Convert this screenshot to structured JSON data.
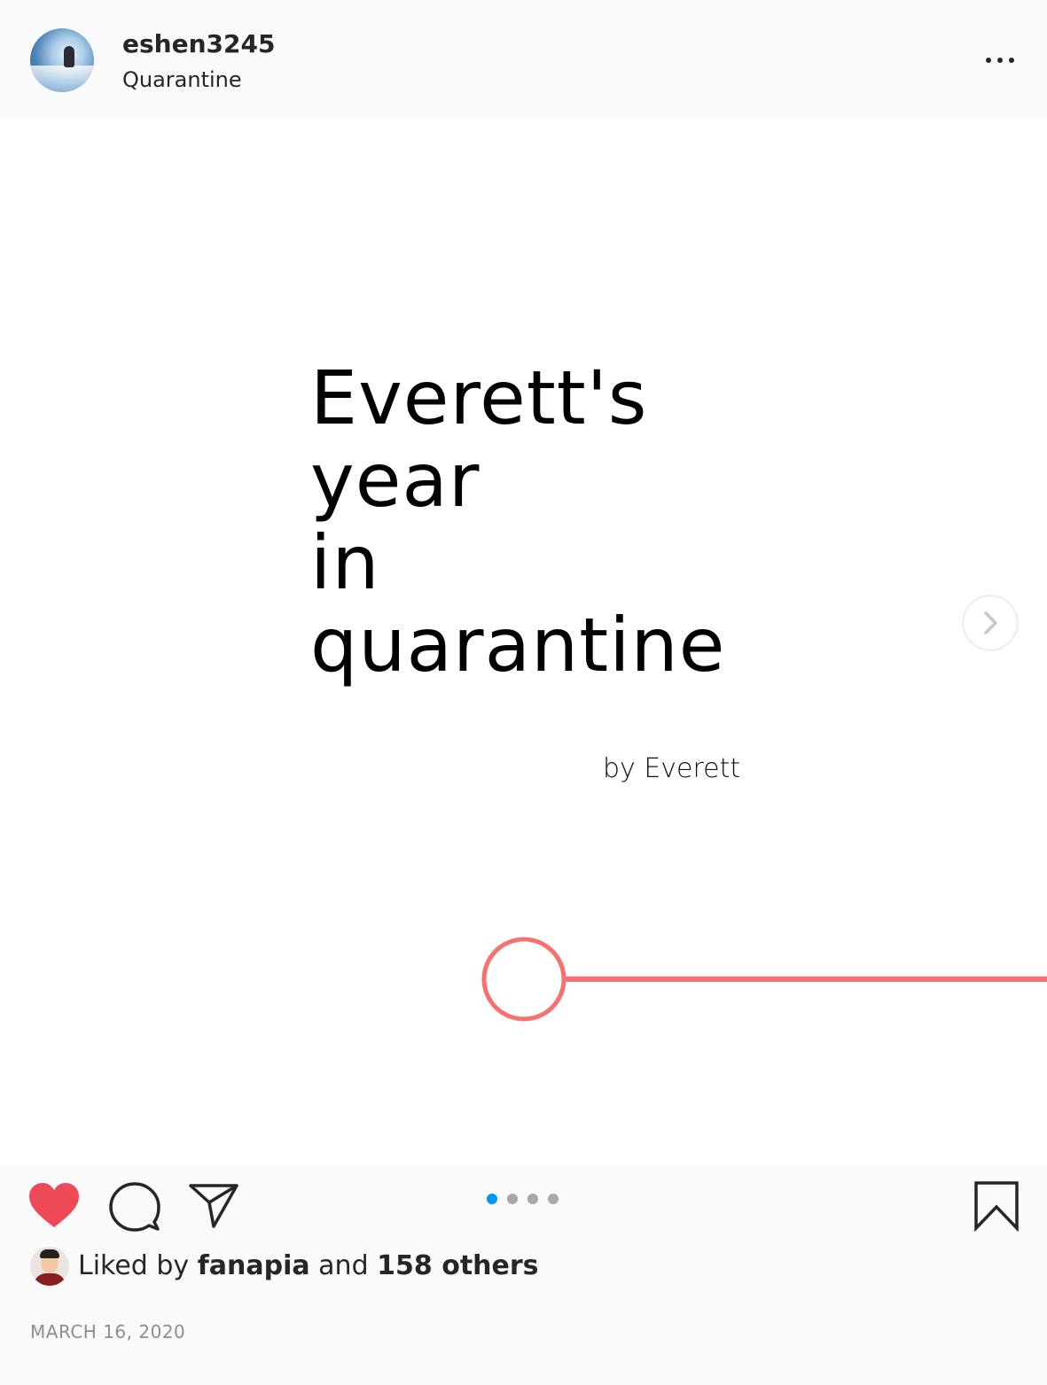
{
  "header": {
    "username": "eshen3245",
    "location": "Quarantine",
    "more_icon": "more-horizontal-icon"
  },
  "slide": {
    "title_lines": [
      "Everett's",
      "year",
      "in",
      "quarantine"
    ],
    "byline": "by Everett",
    "accent_color": "#f87171",
    "next_icon": "chevron-right-icon"
  },
  "carousel": {
    "total_slides": 4,
    "active_index": 0,
    "active_color": "#0095f6",
    "inactive_color": "#a8a8a8"
  },
  "actions": {
    "like_icon": "heart-filled-icon",
    "like_color": "#ed4956",
    "comment_icon": "comment-icon",
    "share_icon": "paper-plane-icon",
    "save_icon": "bookmark-icon"
  },
  "likes": {
    "prefix": "Liked by ",
    "user": "fanapia",
    "middle": " and ",
    "others": "158 others"
  },
  "date": "MARCH 16, 2020"
}
